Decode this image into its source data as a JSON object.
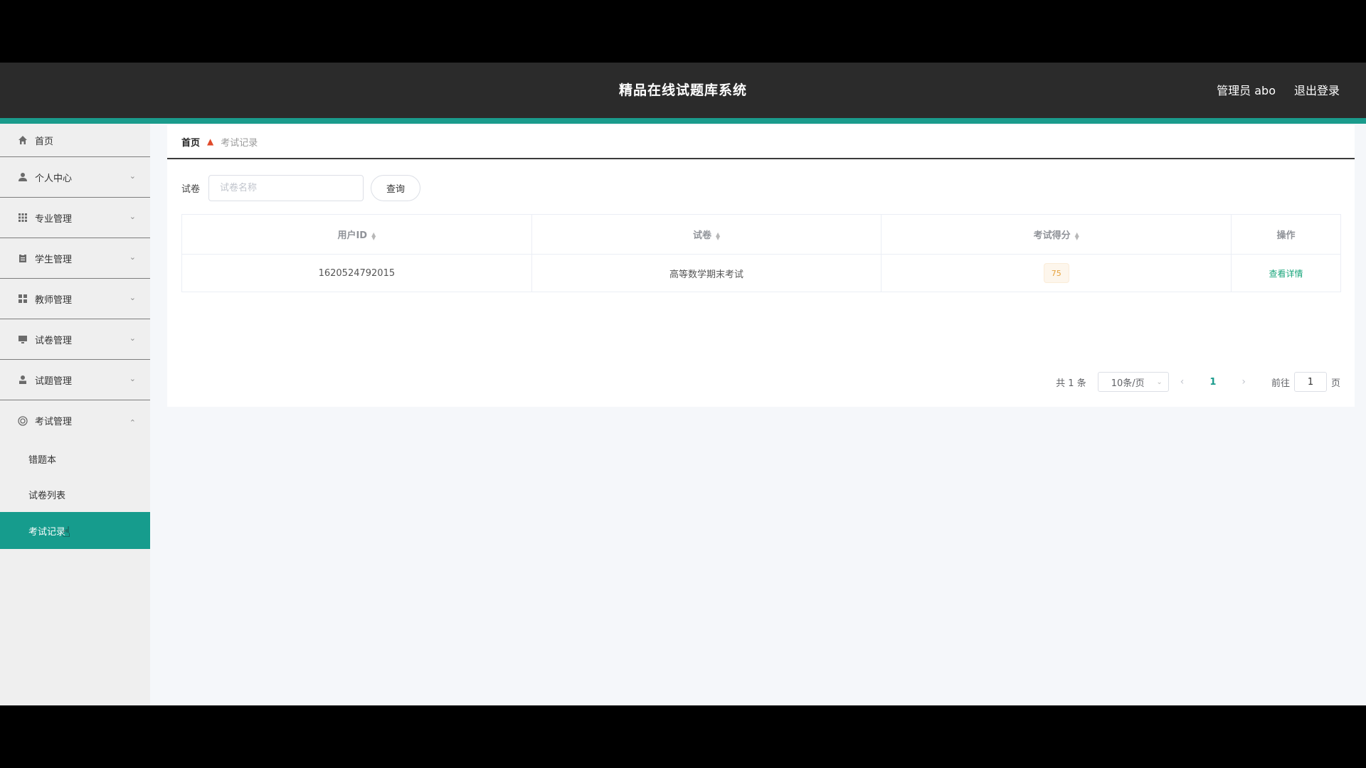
{
  "header": {
    "title": "精品在线试题库系统",
    "user": "管理员 abo",
    "logout": "退出登录"
  },
  "sidebar": {
    "items": [
      {
        "label": "首页",
        "icon": "home-icon"
      },
      {
        "label": "个人中心",
        "icon": "user-icon"
      },
      {
        "label": "专业管理",
        "icon": "grid-icon"
      },
      {
        "label": "学生管理",
        "icon": "clipboard-icon"
      },
      {
        "label": "教师管理",
        "icon": "apps-icon"
      },
      {
        "label": "试卷管理",
        "icon": "monitor-icon"
      },
      {
        "label": "试题管理",
        "icon": "person-icon"
      },
      {
        "label": "考试管理",
        "icon": "circle-icon"
      }
    ],
    "sub_items": [
      {
        "label": "错题本"
      },
      {
        "label": "试卷列表"
      },
      {
        "label": "考试记录"
      }
    ]
  },
  "breadcrumb": {
    "home": "首页",
    "current": "考试记录"
  },
  "search": {
    "label": "试卷",
    "placeholder": "试卷名称",
    "button": "查询"
  },
  "table": {
    "headers": [
      "用户ID",
      "试卷",
      "考试得分",
      "操作"
    ],
    "rows": [
      {
        "user_id": "1620524792015",
        "paper": "高等数学期末考试",
        "score": "75",
        "action": "查看详情"
      }
    ]
  },
  "pagination": {
    "total": "共 1 条",
    "page_size": "10条/页",
    "current": "1",
    "goto_label": "前往",
    "goto_value": "1",
    "page_suffix": "页"
  },
  "colors": {
    "accent": "#1a9b8c",
    "header_bg": "#2b2b2b",
    "score_tag": "#e6a23c"
  }
}
